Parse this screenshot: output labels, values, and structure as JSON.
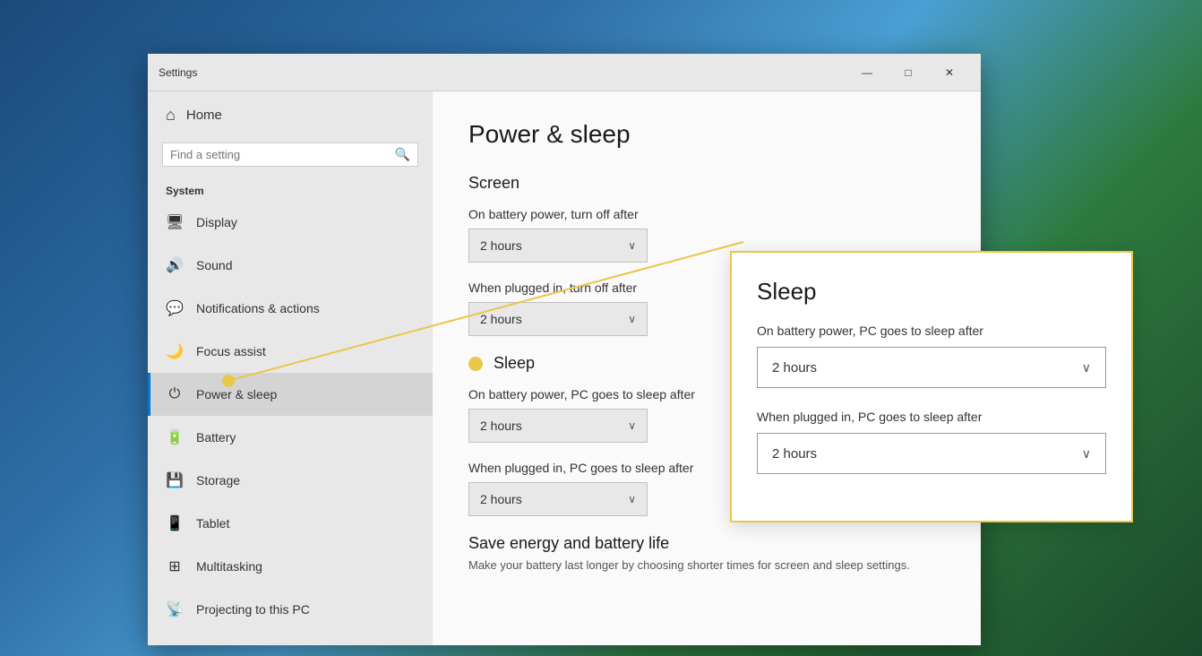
{
  "window": {
    "title": "Settings",
    "controls": {
      "minimize": "—",
      "maximize": "□",
      "close": "✕"
    }
  },
  "sidebar": {
    "home_label": "Home",
    "search_placeholder": "Find a setting",
    "section_label": "System",
    "items": [
      {
        "id": "display",
        "label": "Display",
        "icon": "🖥"
      },
      {
        "id": "sound",
        "label": "Sound",
        "icon": "🔊"
      },
      {
        "id": "notifications",
        "label": "Notifications & actions",
        "icon": "💬"
      },
      {
        "id": "focus-assist",
        "label": "Focus assist",
        "icon": "🌙"
      },
      {
        "id": "power-sleep",
        "label": "Power & sleep",
        "icon": "⏻",
        "active": true
      },
      {
        "id": "battery",
        "label": "Battery",
        "icon": "🔋"
      },
      {
        "id": "storage",
        "label": "Storage",
        "icon": "💾"
      },
      {
        "id": "tablet",
        "label": "Tablet",
        "icon": "📱"
      },
      {
        "id": "multitasking",
        "label": "Multitasking",
        "icon": "⊞"
      },
      {
        "id": "projecting",
        "label": "Projecting to this PC",
        "icon": "📡"
      }
    ]
  },
  "main": {
    "page_title": "Power & sleep",
    "screen_section": {
      "title": "Screen",
      "battery_label": "On battery power, turn off after",
      "battery_value": "2 hours",
      "plugged_label": "When plugged in, turn off after",
      "plugged_value": "2 hours"
    },
    "sleep_section": {
      "title": "Sleep",
      "battery_label": "On battery power, PC goes to sleep after",
      "battery_value": "2 hours",
      "plugged_label": "When plugged in, PC goes to sleep after",
      "plugged_value": "2 hours"
    },
    "save_energy": {
      "title": "Save energy and battery life",
      "description": "Make your battery last longer by choosing shorter times for screen and sleep settings."
    }
  },
  "callout": {
    "title": "Sleep",
    "battery_label": "On battery power, PC goes to sleep after",
    "battery_value": "2 hours",
    "plugged_label": "When plugged in, PC goes to sleep after",
    "plugged_value": "2 hours"
  }
}
